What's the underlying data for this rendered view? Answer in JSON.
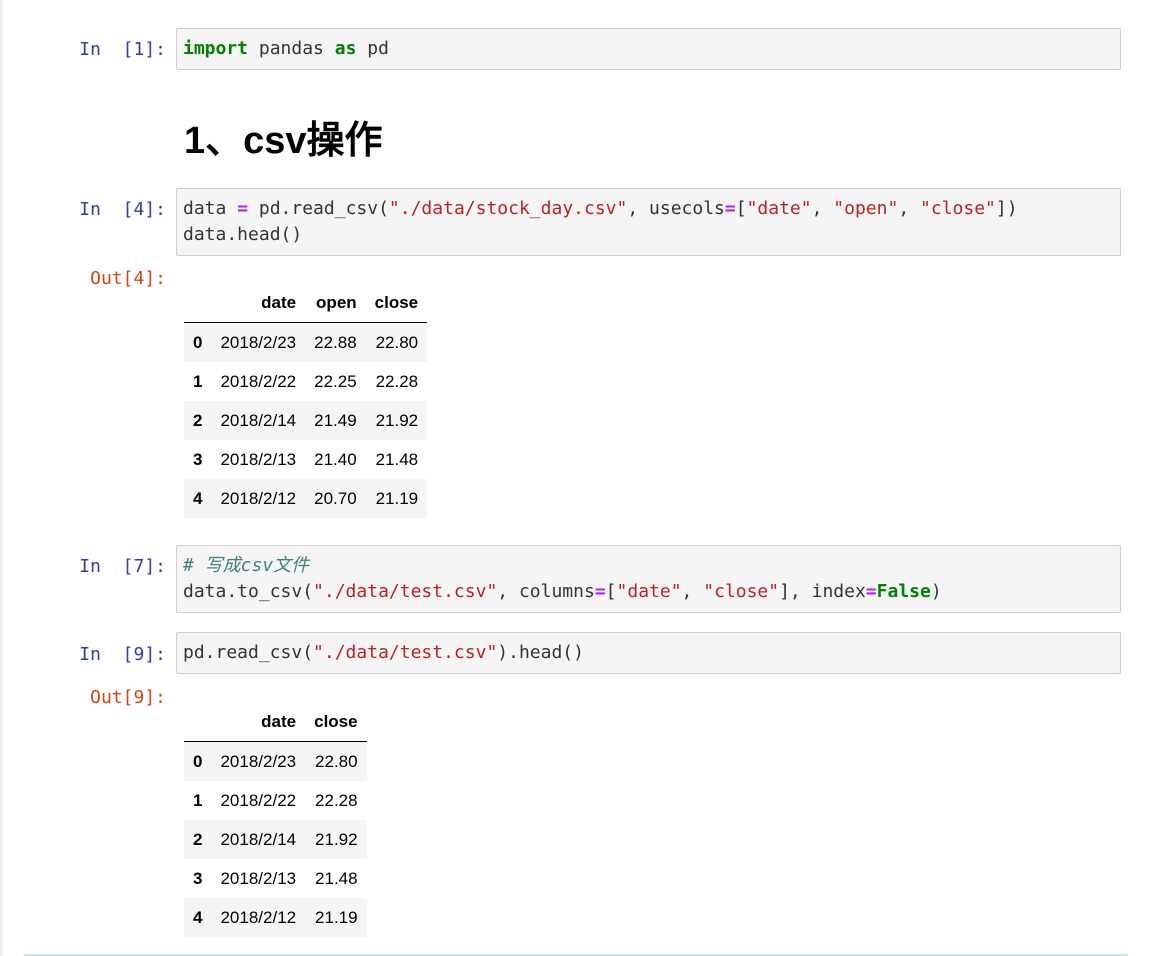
{
  "cells": [
    {
      "prompt": "In  [1]:",
      "lines": [
        [
          {
            "t": "import",
            "c": "kw"
          },
          {
            "t": " pandas ",
            "c": ""
          },
          {
            "t": "as",
            "c": "kw"
          },
          {
            "t": " pd",
            "c": ""
          }
        ]
      ]
    },
    {
      "prompt": "In  [4]:",
      "lines": [
        [
          {
            "t": "data ",
            "c": ""
          },
          {
            "t": "=",
            "c": "op"
          },
          {
            "t": " pd.read_csv(",
            "c": ""
          },
          {
            "t": "\"./data/stock_day.csv\"",
            "c": "str"
          },
          {
            "t": ", usecols",
            "c": ""
          },
          {
            "t": "=",
            "c": "op"
          },
          {
            "t": "[",
            "c": ""
          },
          {
            "t": "\"date\"",
            "c": "str"
          },
          {
            "t": ", ",
            "c": ""
          },
          {
            "t": "\"open\"",
            "c": "str"
          },
          {
            "t": ", ",
            "c": ""
          },
          {
            "t": "\"close\"",
            "c": "str"
          },
          {
            "t": "])",
            "c": ""
          }
        ],
        [
          {
            "t": "data.head()",
            "c": ""
          }
        ]
      ]
    },
    {
      "prompt": "In  [7]:",
      "lines": [
        [
          {
            "t": "# 写成csv文件",
            "c": "cm"
          }
        ],
        [
          {
            "t": "data.to_csv(",
            "c": ""
          },
          {
            "t": "\"./data/test.csv\"",
            "c": "str"
          },
          {
            "t": ", columns",
            "c": ""
          },
          {
            "t": "=",
            "c": "op"
          },
          {
            "t": "[",
            "c": ""
          },
          {
            "t": "\"date\"",
            "c": "str"
          },
          {
            "t": ", ",
            "c": ""
          },
          {
            "t": "\"close\"",
            "c": "str"
          },
          {
            "t": "], index",
            "c": ""
          },
          {
            "t": "=",
            "c": "op"
          },
          {
            "t": "False",
            "c": "kw"
          },
          {
            "t": ")",
            "c": ""
          }
        ]
      ]
    },
    {
      "prompt": "In  [9]:",
      "lines": [
        [
          {
            "t": "pd.read_csv(",
            "c": ""
          },
          {
            "t": "\"./data/test.csv\"",
            "c": "str"
          },
          {
            "t": ").head()",
            "c": ""
          }
        ]
      ]
    }
  ],
  "heading": "1、csv操作",
  "outputs": [
    {
      "prompt": "Out[4]:",
      "columns": [
        "",
        "date",
        "open",
        "close"
      ],
      "rows": [
        [
          "0",
          "2018/2/23",
          "22.88",
          "22.80"
        ],
        [
          "1",
          "2018/2/22",
          "22.25",
          "22.28"
        ],
        [
          "2",
          "2018/2/14",
          "21.49",
          "21.92"
        ],
        [
          "3",
          "2018/2/13",
          "21.40",
          "21.48"
        ],
        [
          "4",
          "2018/2/12",
          "20.70",
          "21.19"
        ]
      ]
    },
    {
      "prompt": "Out[9]:",
      "columns": [
        "",
        "date",
        "close"
      ],
      "rows": [
        [
          "0",
          "2018/2/23",
          "22.80"
        ],
        [
          "1",
          "2018/2/22",
          "22.28"
        ],
        [
          "2",
          "2018/2/14",
          "21.92"
        ],
        [
          "3",
          "2018/2/13",
          "21.48"
        ],
        [
          "4",
          "2018/2/12",
          "21.19"
        ]
      ]
    }
  ],
  "colors": {
    "in_prompt": "#303f9f",
    "out_prompt": "#d84315",
    "keyword": "#008000",
    "string": "#ba2121",
    "operator": "#aa22ff",
    "comment": "#408080"
  }
}
